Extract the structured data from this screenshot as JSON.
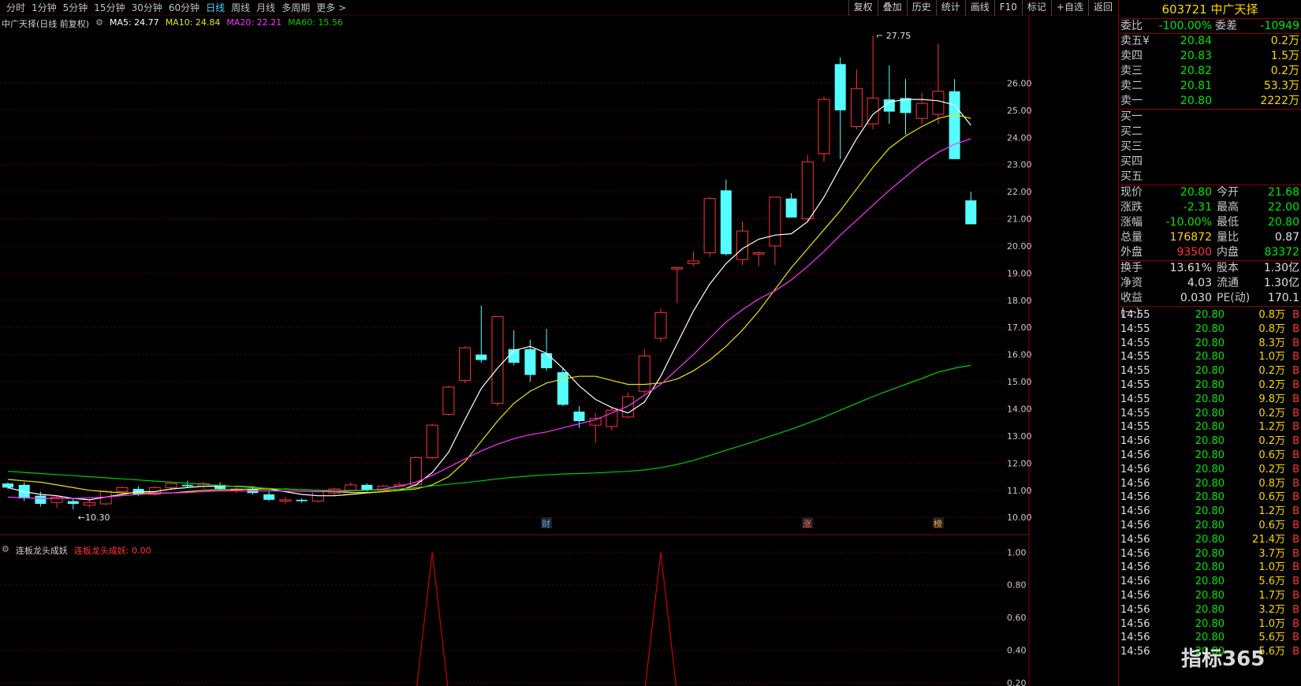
{
  "toolbar": {
    "periods": [
      "分时",
      "1分钟",
      "5分钟",
      "15分钟",
      "30分钟",
      "60分钟",
      "日线",
      "周线",
      "月线",
      "多周期",
      "更多 >"
    ],
    "active_period": "日线",
    "buttons": [
      "复权",
      "叠加",
      "历史",
      "统计",
      "画线",
      "F10",
      "标记",
      "+自选",
      "返回"
    ]
  },
  "legend": {
    "title": "中广天择(日线 前复权)",
    "ma5": "MA5: 24.77",
    "ma10": "MA10: 24.84",
    "ma20": "MA20: 22.21",
    "ma60": "MA60: 15.56",
    "colors": {
      "ma5": "#ffffff",
      "ma10": "#e6e600",
      "ma20": "#ff33ff",
      "ma60": "#00cc00",
      "up": "#ff3333",
      "down": "#55ffff"
    }
  },
  "sub_legend": {
    "name": "连板龙头成妖",
    "value": "连板龙头成妖: 0.00"
  },
  "chart_data": [
    {
      "type": "candlestick",
      "title": "中广天择(日线 前复权)",
      "y_ticks": [
        "26.00",
        "25.00",
        "24.00",
        "23.00",
        "22.00",
        "21.00",
        "20.00",
        "19.00",
        "18.00",
        "17.00",
        "16.00",
        "15.00",
        "14.00",
        "13.00",
        "12.00",
        "11.00",
        "10.00"
      ],
      "ylim": [
        9.6,
        27.9
      ],
      "high_label": "27.75",
      "low_label": "10.30",
      "markers": [
        {
          "index": 33,
          "text": "财"
        },
        {
          "index": 49,
          "text": "涨"
        },
        {
          "index": 57,
          "text": "榜"
        }
      ],
      "ohlc": [
        [
          11.25,
          11.3,
          11.05,
          11.1
        ],
        [
          11.2,
          11.3,
          10.6,
          10.7
        ],
        [
          10.8,
          10.95,
          10.4,
          10.5
        ],
        [
          10.55,
          10.8,
          10.35,
          10.75
        ],
        [
          10.6,
          10.7,
          10.3,
          10.5
        ],
        [
          10.45,
          10.65,
          10.35,
          10.55
        ],
        [
          10.5,
          11.0,
          10.45,
          10.95
        ],
        [
          10.95,
          11.15,
          10.9,
          11.1
        ],
        [
          11.05,
          11.15,
          10.8,
          10.85
        ],
        [
          10.85,
          11.15,
          10.8,
          11.1
        ],
        [
          11.1,
          11.3,
          11.0,
          11.25
        ],
        [
          11.2,
          11.35,
          11.1,
          11.15
        ],
        [
          11.15,
          11.3,
          11.05,
          11.25
        ],
        [
          11.2,
          11.3,
          11.0,
          11.05
        ],
        [
          11.0,
          11.15,
          10.9,
          11.05
        ],
        [
          11.05,
          11.15,
          10.85,
          10.9
        ],
        [
          10.85,
          11.0,
          10.6,
          10.65
        ],
        [
          10.6,
          10.75,
          10.5,
          10.65
        ],
        [
          10.65,
          10.7,
          10.55,
          10.6
        ],
        [
          10.6,
          11.0,
          10.55,
          10.95
        ],
        [
          10.9,
          11.1,
          10.8,
          11.05
        ],
        [
          11.0,
          11.3,
          10.95,
          11.2
        ],
        [
          11.2,
          11.25,
          10.95,
          11.0
        ],
        [
          11.0,
          11.2,
          10.95,
          11.15
        ],
        [
          11.15,
          11.3,
          11.1,
          11.2
        ],
        [
          11.2,
          12.25,
          11.15,
          12.2
        ],
        [
          12.2,
          13.45,
          12.15,
          13.4
        ],
        [
          13.8,
          14.85,
          13.75,
          14.8
        ],
        [
          15.05,
          16.3,
          14.95,
          16.25
        ],
        [
          16.0,
          17.8,
          15.7,
          15.8
        ],
        [
          14.2,
          17.4,
          14.1,
          17.4
        ],
        [
          16.2,
          16.9,
          15.6,
          15.7
        ],
        [
          16.2,
          16.55,
          15.0,
          15.25
        ],
        [
          16.05,
          16.95,
          15.4,
          15.5
        ],
        [
          15.35,
          15.5,
          14.1,
          14.15
        ],
        [
          13.9,
          14.1,
          13.3,
          13.55
        ],
        [
          13.4,
          13.85,
          12.75,
          13.65
        ],
        [
          13.35,
          14.05,
          13.2,
          13.95
        ],
        [
          13.7,
          14.6,
          13.65,
          14.45
        ],
        [
          14.65,
          16.2,
          14.55,
          15.95
        ],
        [
          16.6,
          17.7,
          16.45,
          17.55
        ],
        [
          19.15,
          19.15,
          17.9,
          19.2
        ],
        [
          19.35,
          19.8,
          19.25,
          19.45
        ],
        [
          19.75,
          21.8,
          19.6,
          21.75
        ],
        [
          22.05,
          22.45,
          19.65,
          19.7
        ],
        [
          19.5,
          20.9,
          19.3,
          20.55
        ],
        [
          19.7,
          19.8,
          19.25,
          19.75
        ],
        [
          20.0,
          21.8,
          19.3,
          21.8
        ],
        [
          21.75,
          21.95,
          21.05,
          21.05
        ],
        [
          21.0,
          23.35,
          20.9,
          23.1
        ],
        [
          23.4,
          25.5,
          23.1,
          25.4
        ],
        [
          26.7,
          26.95,
          23.2,
          25.0
        ],
        [
          24.4,
          26.5,
          24.3,
          25.8
        ],
        [
          24.5,
          27.75,
          24.3,
          25.45
        ],
        [
          25.4,
          26.65,
          24.5,
          24.95
        ],
        [
          25.45,
          26.15,
          24.1,
          24.9
        ],
        [
          24.7,
          25.65,
          24.5,
          25.25
        ],
        [
          24.85,
          27.45,
          24.5,
          25.7
        ],
        [
          25.7,
          26.15,
          23.2,
          23.2
        ],
        [
          21.68,
          22.0,
          20.8,
          20.8
        ]
      ],
      "series": [
        {
          "name": "MA5",
          "values": [
            11.1,
            10.95,
            10.85,
            10.8,
            10.7,
            10.65,
            10.75,
            10.85,
            10.95,
            10.95,
            11.05,
            11.1,
            11.15,
            11.15,
            11.15,
            11.12,
            11.05,
            10.95,
            10.85,
            10.8,
            10.8,
            10.85,
            10.9,
            10.95,
            11.0,
            11.2,
            11.65,
            12.4,
            13.6,
            14.75,
            15.5,
            16.15,
            16.3,
            16.05,
            15.5,
            14.85,
            14.35,
            14.05,
            13.85,
            14.25,
            15.2,
            16.4,
            17.6,
            18.6,
            19.35,
            19.9,
            20.25,
            20.4,
            20.45,
            20.9,
            21.8,
            22.9,
            23.95,
            24.85,
            25.3,
            25.4,
            25.4,
            25.35,
            25.2,
            24.45
          ]
        },
        {
          "name": "MA10",
          "values": [
            11.4,
            11.35,
            11.3,
            11.2,
            11.1,
            11.0,
            10.95,
            10.9,
            10.9,
            10.9,
            10.9,
            10.95,
            11.0,
            11.02,
            11.03,
            11.05,
            11.05,
            11.05,
            11.02,
            11.0,
            10.95,
            10.92,
            10.92,
            10.95,
            11.0,
            11.05,
            11.2,
            11.5,
            12.05,
            12.8,
            13.55,
            14.2,
            14.65,
            14.95,
            15.1,
            15.2,
            15.2,
            15.05,
            14.9,
            14.9,
            14.95,
            15.1,
            15.4,
            15.8,
            16.3,
            16.9,
            17.6,
            18.4,
            19.2,
            19.9,
            20.6,
            21.3,
            22.1,
            22.9,
            23.6,
            24.05,
            24.4,
            24.7,
            24.85,
            24.7
          ]
        },
        {
          "name": "MA20",
          "values": [
            10.75,
            10.72,
            10.7,
            10.7,
            10.7,
            10.72,
            10.75,
            10.8,
            10.85,
            10.88,
            10.9,
            10.92,
            10.95,
            10.97,
            10.98,
            10.98,
            10.98,
            10.97,
            10.96,
            10.95,
            10.95,
            10.97,
            11.0,
            11.05,
            11.15,
            11.3,
            11.55,
            11.85,
            12.15,
            12.45,
            12.7,
            12.9,
            13.05,
            13.15,
            13.3,
            13.45,
            13.6,
            13.85,
            14.1,
            14.5,
            14.9,
            15.45,
            16.0,
            16.6,
            17.2,
            17.65,
            18.05,
            18.35,
            18.75,
            19.25,
            19.8,
            20.4,
            20.95,
            21.5,
            22.05,
            22.55,
            23.05,
            23.45,
            23.75,
            23.95
          ]
        },
        {
          "name": "MA60",
          "values": [
            11.7,
            11.66,
            11.62,
            11.58,
            11.54,
            11.5,
            11.46,
            11.42,
            11.38,
            11.34,
            11.3,
            11.26,
            11.22,
            11.18,
            11.14,
            11.1,
            11.07,
            11.04,
            11.02,
            11.0,
            10.99,
            10.99,
            11.0,
            11.02,
            11.05,
            11.1,
            11.16,
            11.22,
            11.28,
            11.35,
            11.42,
            11.48,
            11.53,
            11.57,
            11.6,
            11.62,
            11.64,
            11.67,
            11.7,
            11.75,
            11.83,
            11.95,
            12.1,
            12.28,
            12.48,
            12.66,
            12.85,
            13.05,
            13.25,
            13.47,
            13.7,
            13.95,
            14.2,
            14.45,
            14.68,
            14.9,
            15.12,
            15.35,
            15.5,
            15.6
          ]
        }
      ]
    },
    {
      "type": "line",
      "title": "连板龙头成妖",
      "y_ticks": [
        "1.00",
        "0.80",
        "0.60",
        "0.40",
        "0.20"
      ],
      "ylim": [
        0.18,
        1.05
      ],
      "values": [
        0,
        0,
        0,
        0,
        0,
        0,
        0,
        0,
        0,
        0,
        0,
        0,
        0,
        0,
        0,
        0,
        0,
        0,
        0,
        0,
        0,
        0,
        0,
        0,
        0,
        0,
        1,
        0,
        0,
        0,
        0,
        0,
        0,
        0,
        0,
        0,
        0,
        0,
        0,
        0,
        1,
        0,
        0,
        0,
        0,
        0,
        0,
        0,
        0,
        0,
        0,
        0,
        0,
        0,
        0,
        0,
        0,
        0,
        0,
        0
      ]
    }
  ],
  "quote": {
    "code": "603721",
    "name": "中广天择",
    "weibi_label": "委比",
    "weibi": "-100.00%",
    "weicha_label": "委差",
    "weicha": "-10949",
    "asks": [
      {
        "label": "卖五",
        "mark": "¥",
        "price": "20.84",
        "vol": "0.2万"
      },
      {
        "label": "卖四",
        "mark": "",
        "price": "20.83",
        "vol": "1.5万"
      },
      {
        "label": "卖三",
        "mark": "",
        "price": "20.82",
        "vol": "0.2万"
      },
      {
        "label": "卖二",
        "mark": "",
        "price": "20.81",
        "vol": "53.3万"
      },
      {
        "label": "卖一",
        "mark": "",
        "price": "20.80",
        "vol": "2222万"
      }
    ],
    "bids": [
      {
        "label": "买一"
      },
      {
        "label": "买二"
      },
      {
        "label": "买三"
      },
      {
        "label": "买四"
      },
      {
        "label": "买五"
      }
    ],
    "stats": [
      {
        "l1": "现价",
        "v1": "20.80",
        "c1": "green",
        "l2": "今开",
        "v2": "21.68",
        "c2": "green"
      },
      {
        "l1": "涨跌",
        "v1": "-2.31",
        "c1": "green",
        "l2": "最高",
        "v2": "22.00",
        "c2": "green"
      },
      {
        "l1": "涨幅",
        "v1": "-10.00%",
        "c1": "green",
        "l2": "最低",
        "v2": "20.80",
        "c2": "green"
      },
      {
        "l1": "总量",
        "v1": "176872",
        "c1": "yellow",
        "l2": "量比",
        "v2": "0.87",
        "c2": "white"
      },
      {
        "l1": "外盘",
        "v1": "93500",
        "c1": "red",
        "l2": "内盘",
        "v2": "83372",
        "c2": "green"
      }
    ],
    "stats2": [
      {
        "l1": "换手",
        "v1": "13.61%",
        "l2": "股本",
        "v2": "1.30亿"
      },
      {
        "l1": "净资",
        "v1": "4.03",
        "l2": "流通",
        "v2": "1.30亿"
      },
      {
        "l1": "收益(一)",
        "v1": "0.030",
        "l2": "PE(动)",
        "v2": "170.1"
      }
    ],
    "ticks": [
      {
        "t": "14:55",
        "p": "20.80",
        "v": "0.8万",
        "f": "B"
      },
      {
        "t": "14:55",
        "p": "20.80",
        "v": "0.8万",
        "f": "B"
      },
      {
        "t": "14:55",
        "p": "20.80",
        "v": "8.3万",
        "f": "B"
      },
      {
        "t": "14:55",
        "p": "20.80",
        "v": "1.0万",
        "f": "B"
      },
      {
        "t": "14:55",
        "p": "20.80",
        "v": "0.2万",
        "f": "B"
      },
      {
        "t": "14:55",
        "p": "20.80",
        "v": "0.2万",
        "f": "B"
      },
      {
        "t": "14:55",
        "p": "20.80",
        "v": "9.8万",
        "f": "B"
      },
      {
        "t": "14:55",
        "p": "20.80",
        "v": "0.2万",
        "f": "B"
      },
      {
        "t": "14:55",
        "p": "20.80",
        "v": "1.2万",
        "f": "B"
      },
      {
        "t": "14:56",
        "p": "20.80",
        "v": "0.2万",
        "f": "B"
      },
      {
        "t": "14:56",
        "p": "20.80",
        "v": "0.6万",
        "f": "B"
      },
      {
        "t": "14:56",
        "p": "20.80",
        "v": "0.2万",
        "f": "B"
      },
      {
        "t": "14:56",
        "p": "20.80",
        "v": "0.8万",
        "f": "B"
      },
      {
        "t": "14:56",
        "p": "20.80",
        "v": "0.6万",
        "f": "B"
      },
      {
        "t": "14:56",
        "p": "20.80",
        "v": "1.2万",
        "f": "B"
      },
      {
        "t": "14:56",
        "p": "20.80",
        "v": "0.6万",
        "f": "B"
      },
      {
        "t": "14:56",
        "p": "20.80",
        "v": "21.4万",
        "f": "B"
      },
      {
        "t": "14:56",
        "p": "20.80",
        "v": "3.7万",
        "f": "B"
      },
      {
        "t": "14:56",
        "p": "20.80",
        "v": "1.0万",
        "f": "B"
      },
      {
        "t": "14:56",
        "p": "20.80",
        "v": "5.6万",
        "f": "B"
      },
      {
        "t": "14:56",
        "p": "20.80",
        "v": "1.7万",
        "f": "B"
      },
      {
        "t": "14:56",
        "p": "20.80",
        "v": "3.2万",
        "f": "B"
      },
      {
        "t": "14:56",
        "p": "20.80",
        "v": "1.0万",
        "f": "B"
      },
      {
        "t": "14:56",
        "p": "20.80",
        "v": "5.6万",
        "f": "B"
      },
      {
        "t": "14:56",
        "p": "20.80",
        "v": "5.6万",
        "f": "B"
      }
    ]
  },
  "watermark": "指标365"
}
